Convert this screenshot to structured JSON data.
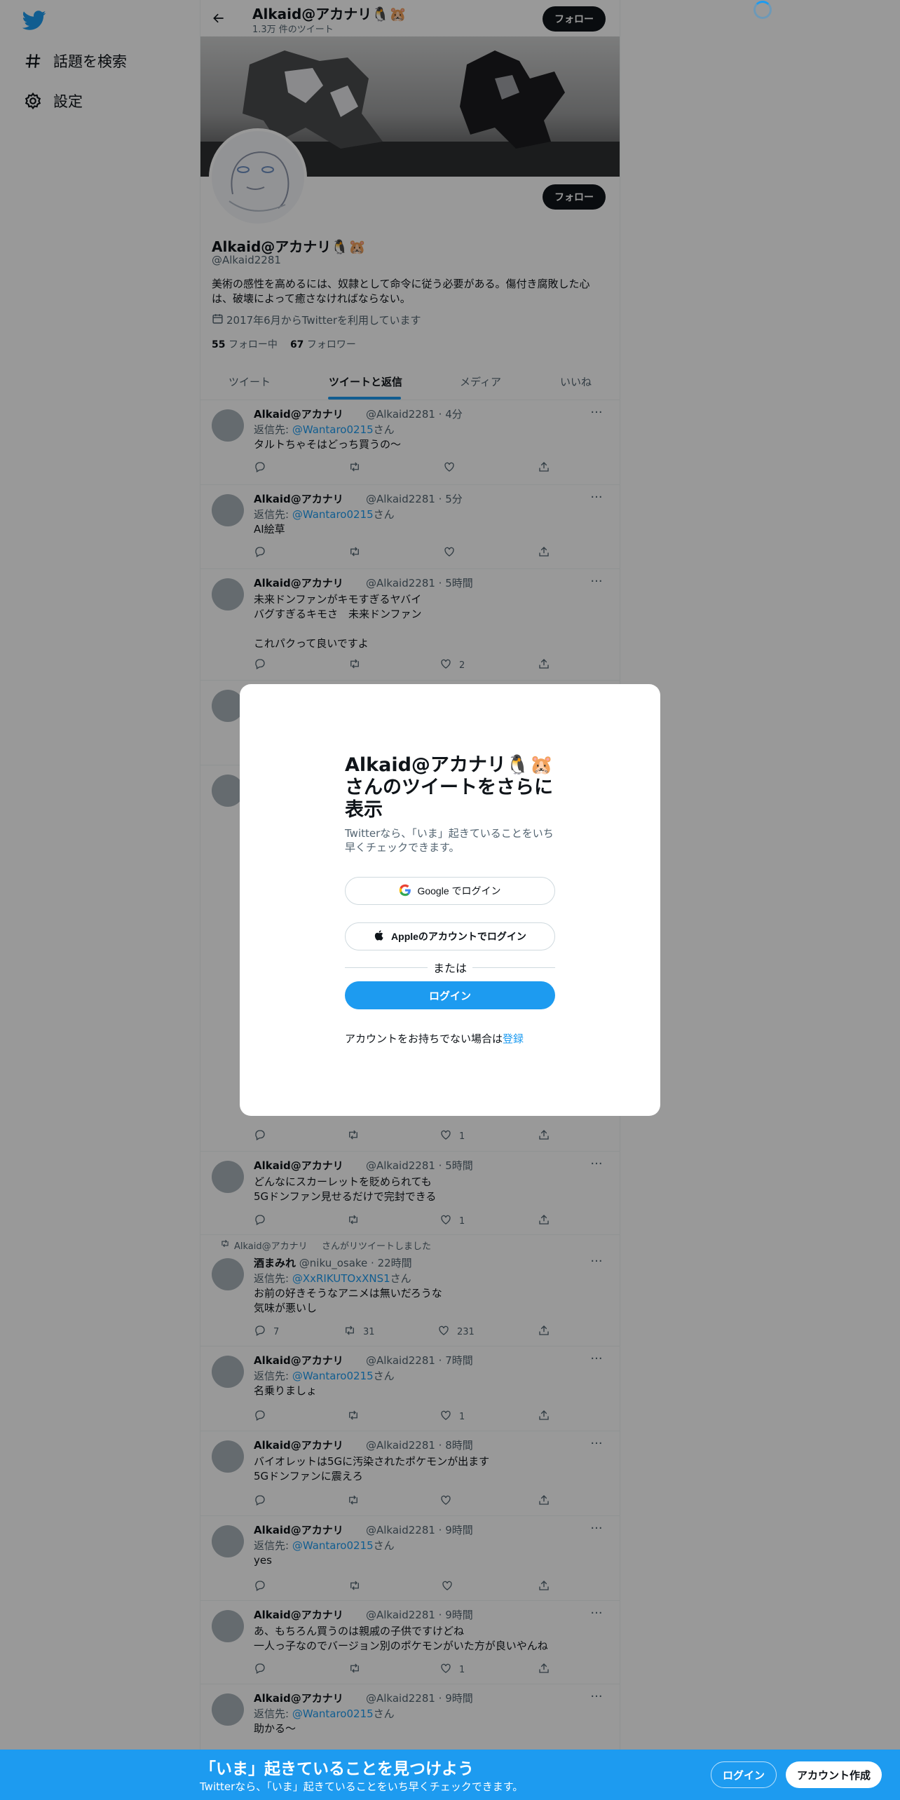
{
  "nav": {
    "logo_icon": "twitter-bird-icon",
    "items": [
      {
        "label": "話題を検索",
        "icon": "hashtag-icon"
      },
      {
        "label": "設定",
        "icon": "gear-icon"
      }
    ]
  },
  "header": {
    "name": "Alkaid@アカナリ🐧🐹",
    "tweet_count": "1.3万 件のツイート",
    "follow_label": "フォロー"
  },
  "profile": {
    "name": "Alkaid@アカナリ🐧🐹",
    "handle": "@Alkaid2281",
    "bio": "美術の感性を高めるには、奴隷として命令に従う必要がある。傷付き腐敗した心は、破壊によって癒さなければならない。",
    "joined": "2017年6月からTwitterを利用しています",
    "following_count": "55",
    "following_label": "フォロー中",
    "followers_count": "67",
    "followers_label": "フォロワー",
    "follow_label": "フォロー"
  },
  "tabs": [
    "ツイート",
    "ツイートと返信",
    "メディア",
    "いいね"
  ],
  "tweets": [
    {
      "name": "Alkaid@アカナリ",
      "handle": "@Alkaid2281 · 4分",
      "reply_prefix": "返信先: ",
      "reply_to": "@Wantaro0215",
      "reply_suffix": "さん",
      "text": "タルトちゃそはどっち買うの〜",
      "like": ""
    },
    {
      "name": "Alkaid@アカナリ",
      "handle": "@Alkaid2281 · 5分",
      "reply_prefix": "返信先: ",
      "reply_to": "@Wantaro0215",
      "reply_suffix": "さん",
      "text": "AI絵草",
      "like": ""
    },
    {
      "name": "Alkaid@アカナリ",
      "handle": "@Alkaid2281 · 5時間",
      "text": "未来ドンファンがキモすぎるヤバイ\nバグすぎるキモさ　未来ドンファン\n\nこれパクって良いですよ",
      "like": "2"
    },
    {
      "like": "1"
    },
    {
      "name": "Alkaid@アカナリ",
      "handle": "@Alkaid2281 · 5時間",
      "text": "どんなにスカーレットを貶められても\n5Gドンファン見せるだけで完封できる",
      "like": "1"
    },
    {
      "retweeter": "Alkaid@アカナリ",
      "retweet_label": "さんがリツイートしました",
      "name": "酒まみれ",
      "handle": "@niku_osake · 22時間",
      "reply_prefix": "返信先: ",
      "reply_to": "@XxRIKUTOxXNS1",
      "reply_suffix": "さん",
      "text": "お前の好きそうなアニメは無いだろうな\n気味が悪いし",
      "reply_count": "7",
      "retweet_count": "31",
      "like": "231"
    },
    {
      "name": "Alkaid@アカナリ",
      "handle": "@Alkaid2281 · 7時間",
      "reply_prefix": "返信先: ",
      "reply_to": "@Wantaro0215",
      "reply_suffix": "さん",
      "text": "名乗りましょ",
      "like": "1"
    },
    {
      "name": "Alkaid@アカナリ",
      "handle": "@Alkaid2281 · 8時間",
      "text": "バイオレットは5Gに汚染されたポケモンが出ます\n5Gドンファンに震えろ",
      "like": ""
    },
    {
      "name": "Alkaid@アカナリ",
      "handle": "@Alkaid2281 · 9時間",
      "reply_prefix": "返信先: ",
      "reply_to": "@Wantaro0215",
      "reply_suffix": "さん",
      "text": "yes",
      "like": ""
    },
    {
      "name": "Alkaid@アカナリ",
      "handle": "@Alkaid2281 · 9時間",
      "text": "あ、もちろん買うのは親戚の子供ですけどね\n一人っ子なのでバージョン別のポケモンがいた方が良いやんね",
      "like": "1"
    },
    {
      "name": "Alkaid@アカナリ",
      "handle": "@Alkaid2281 · 9時間",
      "reply_prefix": "返信先: ",
      "reply_to": "@Wantaro0215",
      "reply_suffix": "さん",
      "text": "助かる〜"
    }
  ],
  "modal": {
    "title": "Alkaid@アカナリ🐧🐹さんのツイートをさらに表示",
    "subtitle": "Twitterなら、「いま」起きていることをいち早くチェックできます。",
    "google_label": "Google でログイン",
    "apple_label": "Appleのアカウントでログイン",
    "or_label": "または",
    "login_label": "ログイン",
    "signup_prompt": "アカウントをお持ちでない場合は",
    "signup_link": "登録"
  },
  "bottom_bar": {
    "title": "「いま」起きていることを見つけよう",
    "subtitle": "Twitterなら、「いま」起きていることをいち早くチェックできます。",
    "login_label": "ログイン",
    "signup_label": "アカウント作成"
  },
  "colors": {
    "accent": "#1d9bf0",
    "text": "#0f1419",
    "muted": "#536471"
  }
}
